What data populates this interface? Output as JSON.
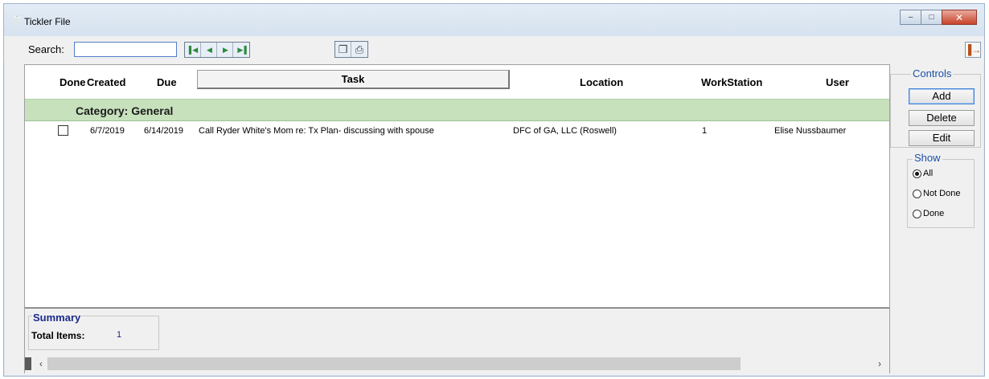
{
  "window": {
    "title": "Tickler File"
  },
  "toolbar": {
    "search_label": "Search:",
    "search_value": "",
    "nav_buttons": [
      "first-record",
      "previous-record",
      "next-record",
      "last-record"
    ],
    "doc_buttons": [
      "copy",
      "print"
    ]
  },
  "grid": {
    "columns": {
      "done": "Done",
      "created": "Created",
      "due": "Due",
      "task": "Task",
      "location": "Location",
      "workstation": "WorkStation",
      "user": "User"
    },
    "category_label": "Category: General",
    "rows": [
      {
        "done": false,
        "created": "6/7/2019",
        "due": "6/14/2019",
        "task": "Call Ryder White's Mom re: Tx Plan- discussing with spouse",
        "location": "DFC of GA, LLC (Roswell)",
        "workstation": "1",
        "user": "Elise Nussbaumer"
      }
    ]
  },
  "summary": {
    "title": "Summary",
    "total_label": "Total Items:",
    "total_value": "1"
  },
  "controls": {
    "title": "Controls",
    "add": "Add",
    "delete": "Delete",
    "edit": "Edit"
  },
  "show": {
    "title": "Show",
    "options": [
      {
        "label": "All",
        "checked": true
      },
      {
        "label": "Not Done",
        "checked": false
      },
      {
        "label": "Done",
        "checked": false
      }
    ]
  },
  "colors": {
    "category_bg": "#c7e1bd",
    "group_title": "#1c4fa8",
    "summary_title": "#1b2a8a"
  }
}
